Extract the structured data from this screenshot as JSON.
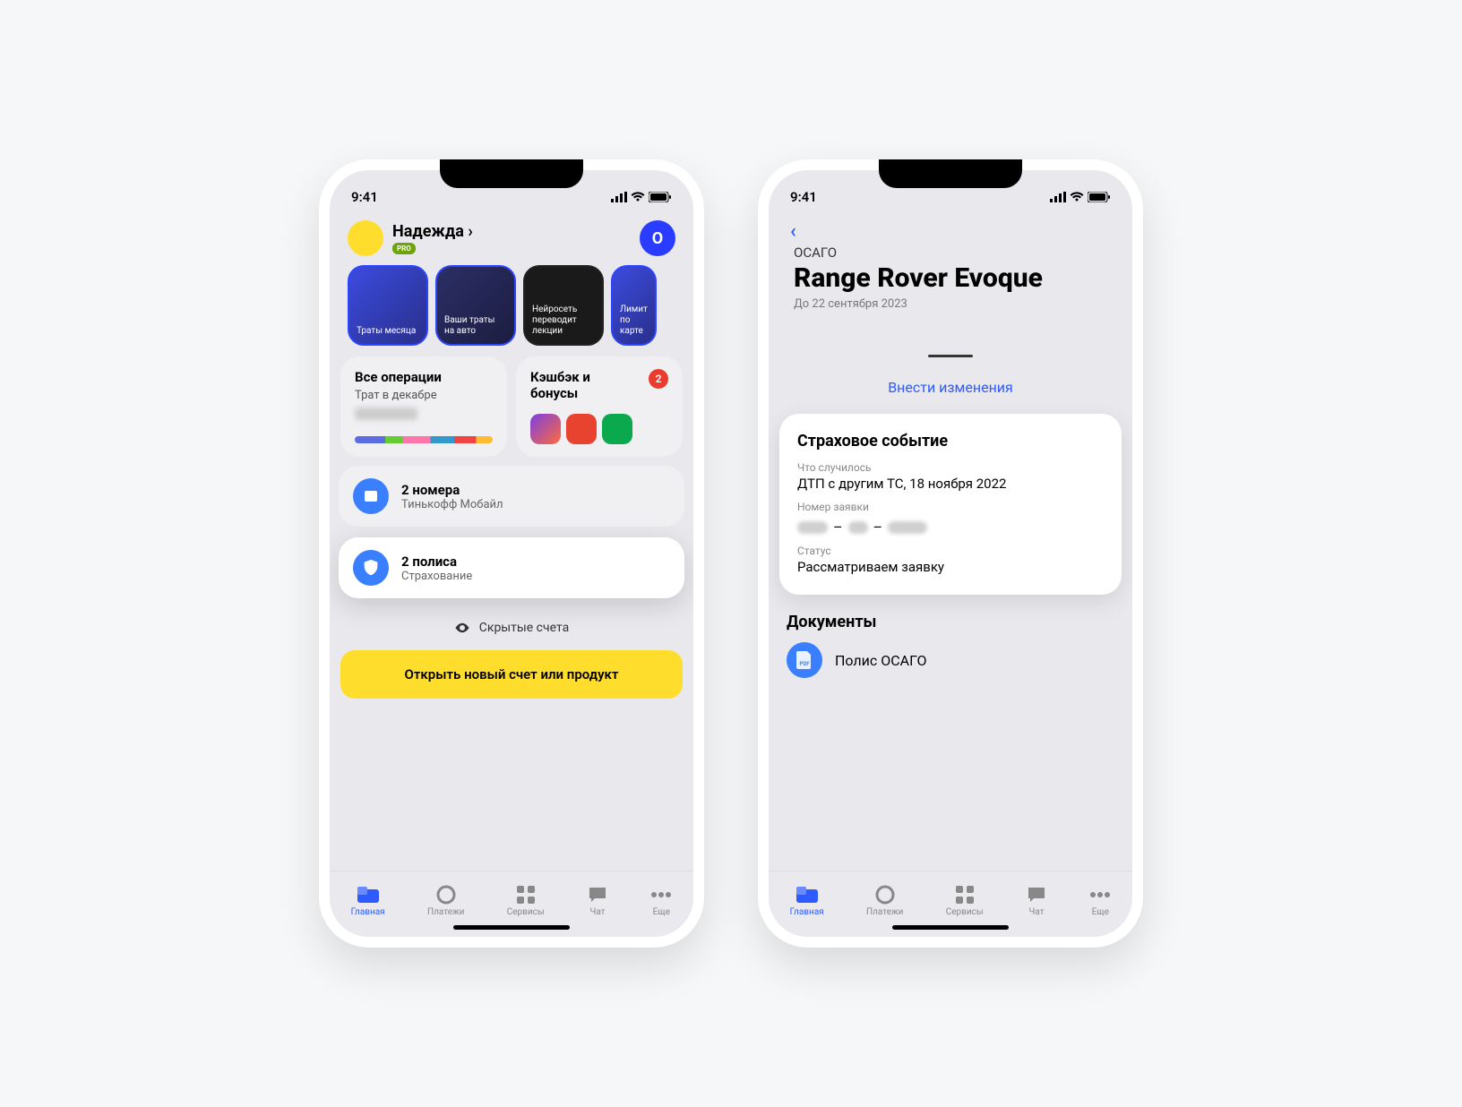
{
  "status": {
    "time": "9:41"
  },
  "phone1": {
    "user_name": "Надежда ›",
    "pro": "PRO",
    "avatar_letter": "O",
    "stories": [
      {
        "label": "Траты месяца"
      },
      {
        "label": "Ваши траты на авто"
      },
      {
        "label": "Нейросеть переводит лекции"
      },
      {
        "label": "Лимит по карте"
      }
    ],
    "ops": {
      "title": "Все операции",
      "sub": "Трат в декабре"
    },
    "cashback": {
      "title": "Кэшбэк и бонусы",
      "badge": "2"
    },
    "mobile": {
      "title": "2 номера",
      "sub": "Тинькофф Мобайл"
    },
    "insurance": {
      "title": "2 полиса",
      "sub": "Страхование"
    },
    "hidden": "Скрытые счета",
    "cta": "Открыть новый счет или продукт"
  },
  "phone2": {
    "overline": "ОСАГО",
    "title": "Range Rover Evoque",
    "until": "До 22 сентября 2023",
    "change_link": "Внести изменения",
    "event": {
      "heading": "Страховое событие",
      "what_label": "Что случилось",
      "what_value": "ДТП с другим ТС, 18 ноября 2022",
      "claim_label": "Номер заявки",
      "status_label": "Статус",
      "status_value": "Рассматриваем заявку"
    },
    "docs": {
      "heading": "Документы",
      "policy": "Полис ОСАГО",
      "pdf": "PDF"
    }
  },
  "tabs": {
    "home": "Главная",
    "pay": "Платежи",
    "serv": "Сервисы",
    "chat": "Чат",
    "more": "Еще"
  }
}
